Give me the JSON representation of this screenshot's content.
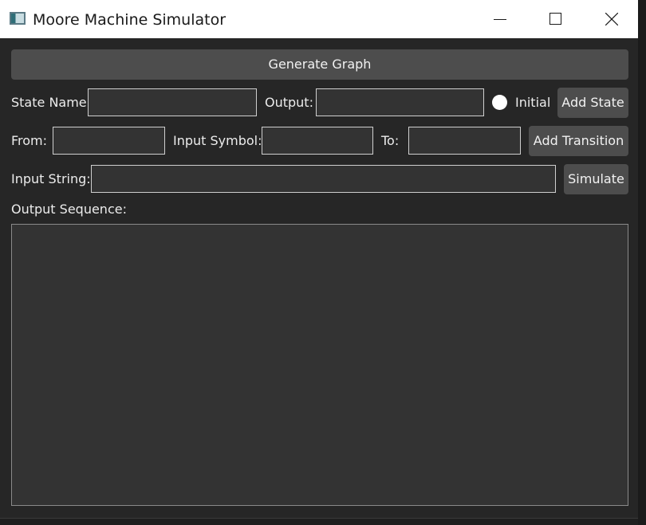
{
  "window": {
    "title": "Moore Machine Simulator",
    "icons": [
      "app-icon",
      "minimize-icon",
      "maximize-icon",
      "close-icon"
    ]
  },
  "toolbar": {
    "generate_graph_label": "Generate Graph"
  },
  "state_row": {
    "state_name_label": "State Name:",
    "state_name_value": "",
    "output_label": "Output:",
    "output_value": "",
    "initial_label": "Initial",
    "add_state_label": "Add State"
  },
  "transition_row": {
    "from_label": "From:",
    "from_value": "",
    "input_symbol_label": "Input Symbol:",
    "input_symbol_value": "",
    "to_label": "To:",
    "to_value": "",
    "add_transition_label": "Add Transition"
  },
  "simulate_row": {
    "input_string_label": "Input String:",
    "input_string_value": "",
    "simulate_label": "Simulate"
  },
  "output": {
    "label": "Output Sequence:",
    "value": ""
  },
  "colors": {
    "background": "#262626",
    "button": "#4d4d4d",
    "field": "#333333",
    "titlebar": "#ffffff"
  }
}
